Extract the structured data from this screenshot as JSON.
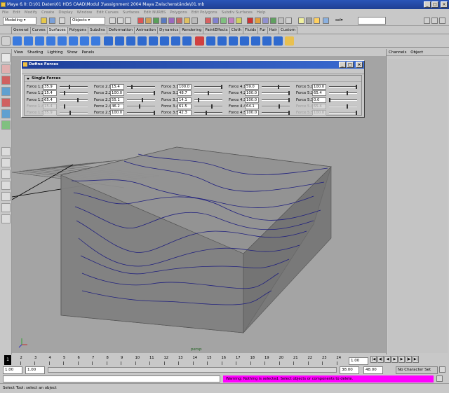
{
  "window": {
    "title": "Maya 6.0: D:\\01 Daten\\01 HDS CAAD\\Modul 3\\assignment 2004 Maya Zwischenstände\\01.mb"
  },
  "menus": [
    "File",
    "Edit",
    "Modify",
    "Create",
    "Display",
    "Window",
    "Edit Curves",
    "Surfaces",
    "Edit NURBS",
    "Polygons",
    "Edit Polygons",
    "Subdiv Surfaces",
    "Help"
  ],
  "status": {
    "mode": "Modeling",
    "selection_mask": "Objects",
    "sel_label": "sel"
  },
  "shelf_tabs": [
    "General",
    "Curves",
    "Surfaces",
    "Polygons",
    "Subdivs",
    "Deformation",
    "Animation",
    "Dynamics",
    "Rendering",
    "PaintEffects",
    "Cloth",
    "Fluids",
    "Fur",
    "Hair",
    "Custom"
  ],
  "shelf_active": "Surfaces",
  "panel_menu": [
    "View",
    "Shading",
    "Lighting",
    "Show",
    "Panels"
  ],
  "right_panel": {
    "tabs": [
      "Channels",
      "Object"
    ]
  },
  "dialog": {
    "title": "Define Forces",
    "section": "Single Forces",
    "rows": [
      [
        {
          "label": "Force 1.1",
          "value": "35.9",
          "level": 0.35
        },
        {
          "label": "Force 2.1",
          "value": "15.4",
          "level": 0.15
        },
        {
          "label": "Force 3.1",
          "value": "100.0",
          "level": 1.0
        },
        {
          "label": "Force 4.1",
          "value": "59.0",
          "level": 0.6
        },
        {
          "label": "Force 5.1",
          "value": "100.0",
          "level": 1.0
        }
      ],
      [
        {
          "label": "Force 1.2",
          "value": "15.4",
          "level": 0.15
        },
        {
          "label": "Force 2.2",
          "value": "100.0",
          "level": 1.0
        },
        {
          "label": "Force 3.2",
          "value": "48.7",
          "level": 0.49
        },
        {
          "label": "Force 4.2",
          "value": "100.0",
          "level": 1.0
        },
        {
          "label": "Force 5.2",
          "value": "65.4",
          "level": 0.65
        }
      ],
      [
        {
          "label": "Force 1.3",
          "value": "65.4",
          "level": 0.65
        },
        {
          "label": "Force 2.3",
          "value": "55.1",
          "level": 0.55
        },
        {
          "label": "Force 3.3",
          "value": "14.1",
          "level": 0.14
        },
        {
          "label": "Force 4.3",
          "value": "100.0",
          "level": 1.0
        },
        {
          "label": "Force 5.3",
          "value": "0.0",
          "level": 0.0
        }
      ],
      [
        {
          "label": "Force 1.4",
          "value": "15.4",
          "level": 0.15,
          "dim": true
        },
        {
          "label": "Force 2.4",
          "value": "46.2",
          "level": 0.46
        },
        {
          "label": "Force 3.4",
          "value": "61.5",
          "level": 0.62
        },
        {
          "label": "Force 4.4",
          "value": "64.1",
          "level": 0.64
        },
        {
          "label": "Force 5.4",
          "value": "65.4",
          "level": 0.65,
          "dim": true
        }
      ],
      [
        {
          "label": "Force 1.5",
          "value": "35.9",
          "level": 0.36,
          "dim": true
        },
        {
          "label": "Force 2.5",
          "value": "100.0",
          "level": 1.0
        },
        {
          "label": "Force 3.5",
          "value": "42.3",
          "level": 0.42
        },
        {
          "label": "Force 4.5",
          "value": "100.0",
          "level": 1.0
        },
        {
          "label": "Force 5.5",
          "value": "100.0",
          "level": 1.0,
          "dim": true
        }
      ]
    ]
  },
  "viewport": {
    "camera_label": "persp"
  },
  "time": {
    "ticks": [
      "1",
      "2",
      "3",
      "4",
      "5",
      "6",
      "7",
      "8",
      "9",
      "10",
      "11",
      "12",
      "13",
      "14",
      "15",
      "16",
      "17",
      "18",
      "19",
      "20",
      "21",
      "22",
      "23",
      "24"
    ],
    "current": "1.00",
    "start": "1.00",
    "range_start": "1.00",
    "range_end": "38.00",
    "end": "48.00",
    "character": "No Character Set"
  },
  "warning": "Warning: Nothing is selected. Select objects or components to delete.",
  "help": "Select Tool: select an object",
  "colors": {
    "title": "#1f3f93",
    "viewport": "#a4a4a4",
    "curve": "#202080",
    "warning": "#ff00ff"
  }
}
